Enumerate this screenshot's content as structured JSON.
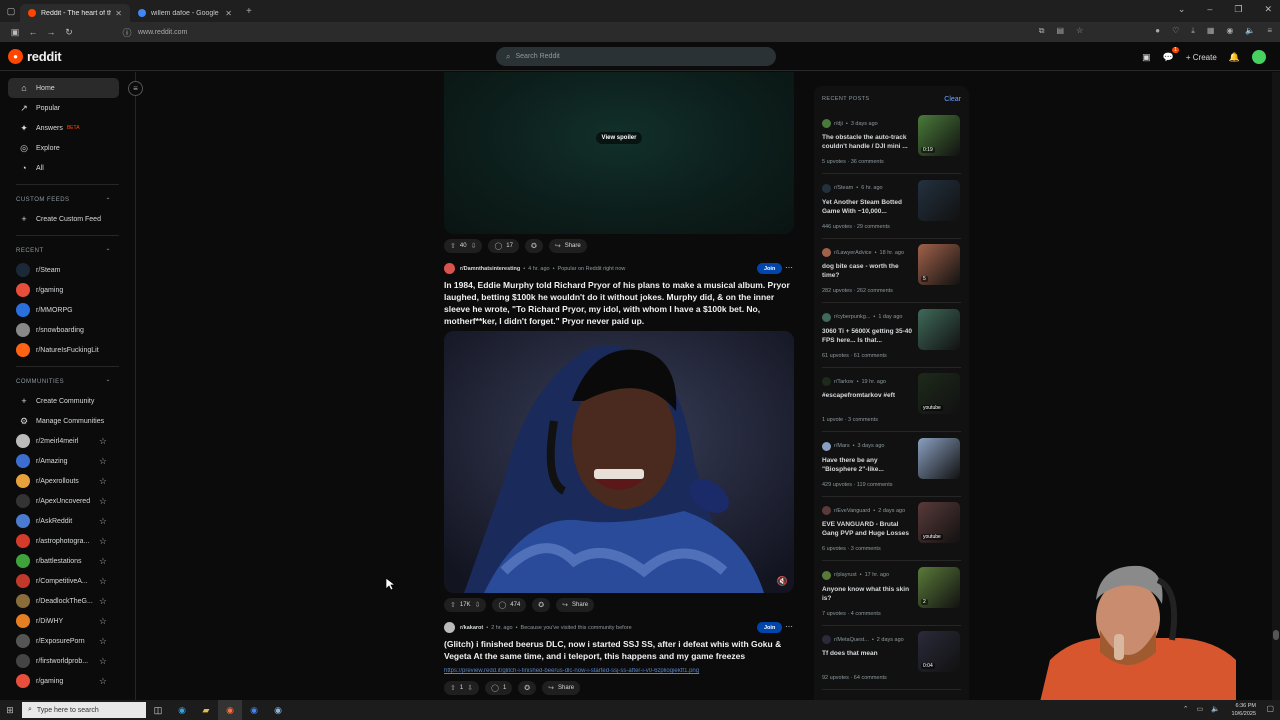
{
  "browser": {
    "tabs": [
      {
        "title": "Reddit - The heart of the in",
        "active": true
      },
      {
        "title": "willem dafoe - Google Search",
        "active": false
      }
    ],
    "url": "www.reddit.com"
  },
  "header": {
    "logo_text": "reddit",
    "search_placeholder": "Search Reddit",
    "create_label": "Create",
    "chat_count": "1"
  },
  "sidebar": {
    "nav": [
      {
        "label": "Home",
        "icon": "home-icon",
        "glyph": "⌂"
      },
      {
        "label": "Popular",
        "icon": "popular-icon",
        "glyph": "↗"
      },
      {
        "label": "Answers",
        "icon": "answers-icon",
        "glyph": "✦",
        "badge": "BETA"
      },
      {
        "label": "Explore",
        "icon": "explore-icon",
        "glyph": "◎"
      },
      {
        "label": "All",
        "icon": "all-icon",
        "glyph": "◔"
      }
    ],
    "custom_feeds_heading": "CUSTOM FEEDS",
    "create_custom_feed": "Create Custom Feed",
    "recent_heading": "RECENT",
    "recent": [
      {
        "label": "r/Steam",
        "color": "#1b2838"
      },
      {
        "label": "r/gaming",
        "color": "#e84e3c"
      },
      {
        "label": "r/MMORPG",
        "color": "#2a6fdb"
      },
      {
        "label": "r/snowboarding",
        "color": "#888888"
      },
      {
        "label": "r/NatureIsFuckingLit",
        "color": "#ff6314"
      }
    ],
    "communities_heading": "COMMUNITIES",
    "create_community": "Create Community",
    "manage_communities": "Manage Communities",
    "communities": [
      {
        "label": "r/2meirl4meirl",
        "color": "#bbbbbb"
      },
      {
        "label": "r/Amazing",
        "color": "#3d6ecf"
      },
      {
        "label": "r/Apexrollouts",
        "color": "#e8a23c"
      },
      {
        "label": "r/ApexUncovered",
        "color": "#333333"
      },
      {
        "label": "r/AskReddit",
        "color": "#4a7bd0"
      },
      {
        "label": "r/astrophotogra...",
        "color": "#d43b2a"
      },
      {
        "label": "r/battlestations",
        "color": "#3ea33a"
      },
      {
        "label": "r/CompetitiveA...",
        "color": "#c0392b"
      },
      {
        "label": "r/DeadlockTheG...",
        "color": "#8a6d3b"
      },
      {
        "label": "r/DiWHY",
        "color": "#e67e22"
      },
      {
        "label": "r/ExposurePorn",
        "color": "#555555"
      },
      {
        "label": "r/firstworldprob...",
        "color": "#444444"
      },
      {
        "label": "r/gaming",
        "color": "#e84e3c"
      }
    ]
  },
  "feed": {
    "spoiler_post": {
      "view_spoiler": "View spoiler",
      "upvotes": "40",
      "comments": "17",
      "share": "Share"
    },
    "post1": {
      "subreddit": "r/Damnthatsinteresting",
      "time": "4 hr. ago",
      "context": "Popular on Reddit right now",
      "join": "Join",
      "title": "In 1984, Eddie Murphy told Richard Pryor of his plans to make a musical album. Pryor laughed, betting $100k he wouldn't do it without jokes. Murphy did, & on the inner sleeve he wrote, \"To Richard Pryor, my idol, with whom I have a $100k bet. No, motherf**ker, I didn't forget.\" Pryor never paid up.",
      "upvotes": "17K",
      "comments": "474",
      "share": "Share"
    },
    "post2": {
      "subreddit": "r/kakarot",
      "time": "2 hr. ago",
      "context": "Because you've visited this community before",
      "join": "Join",
      "title": "(Glitch) i finished beerus DLC, now i started SSJ SS, after i defeat whis with Goku & Vegeta At the same time, and i teleport, this happens and my game freezes",
      "link": "https://preview.redd.it/glitch-i-finished-beerus-dlc-now-i-started-ssj-ss-after-i-v0-6zpliogiektf1.png",
      "upvotes": "1",
      "comments": "1",
      "share": "Share"
    }
  },
  "recent_posts": {
    "heading": "RECENT POSTS",
    "clear": "Clear",
    "items": [
      {
        "sub": "r/dji",
        "time": "3 days ago",
        "title": "The obstacle the auto-track couldn't handle / DJI mini ...",
        "stats": "5 upvotes · 36 comments",
        "badge": "0:19",
        "color": "#4a7a3a"
      },
      {
        "sub": "r/Steam",
        "time": "6 hr. ago",
        "title": "Yet Another Steam Botted Game With ~10,000...",
        "stats": "446 upvotes · 29 comments",
        "badge": "",
        "color": "#23313f"
      },
      {
        "sub": "r/LawyerAdvice",
        "time": "18 hr. ago",
        "title": "dog bite case - worth the time?",
        "stats": "282 upvotes · 262 comments",
        "badge": "5",
        "color": "#a0614a"
      },
      {
        "sub": "r/cyberpunkg...",
        "time": "1 day ago",
        "title": "3060 Ti + 5600X getting 35-40 FPS here... Is that...",
        "stats": "61 upvotes · 61 comments",
        "badge": "",
        "color": "#3f6a5a"
      },
      {
        "sub": "r/Tarkov",
        "time": "19 hr. ago",
        "title": "#escapefromtarkov #eft",
        "stats": "1 upvote · 3 comments",
        "badge": "youtube",
        "color": "#1e2a1a"
      },
      {
        "sub": "r/Mars",
        "time": "3 days ago",
        "title": "Have there be any \"Biosphere 2\"-like...",
        "stats": "429 upvotes · 119 comments",
        "badge": "",
        "color": "#8aa0c0"
      },
      {
        "sub": "r/EveVanguard",
        "time": "2 days ago",
        "title": "EVE VANGUARD - Brutal Gang PVP and Huge Losses",
        "stats": "6 upvotes · 3 comments",
        "badge": "youtube",
        "color": "#5a3a3a"
      },
      {
        "sub": "r/playrust",
        "time": "17 hr. ago",
        "title": "Anyone know what this skin is?",
        "stats": "7 upvotes · 4 comments",
        "badge": "2",
        "color": "#5a7a3a"
      },
      {
        "sub": "r/MetaQuest...",
        "time": "2 days ago",
        "title": "Tf does that mean",
        "stats": "92 upvotes · 64 comments",
        "badge": "0:04",
        "color": "#2a2a3a"
      }
    ]
  },
  "taskbar": {
    "search_placeholder": "Type here to search",
    "time": "6:36 PM",
    "date": "10/6/2025"
  }
}
